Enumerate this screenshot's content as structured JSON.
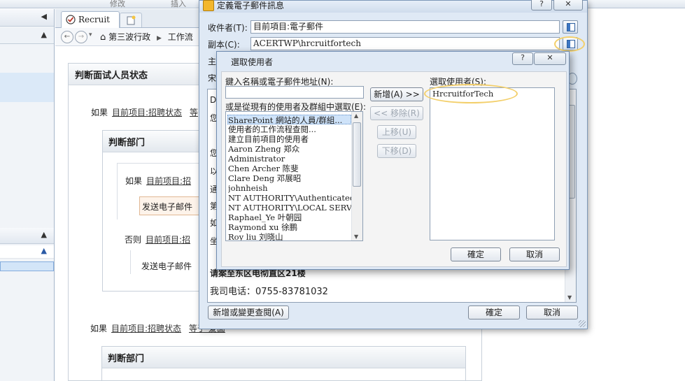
{
  "background": {
    "ribbon_labels": [
      "修改",
      "插入"
    ],
    "tab_label": "Recruit",
    "breadcrumb": [
      "第三波行政",
      "工作流"
    ],
    "main_box_title": "判断面试人员状态",
    "if_label": "如果",
    "field_ref": "目前项目:招聘状态",
    "eq_fragment": "等",
    "sub_box_title": "判断部门",
    "nested_field_ref": "目前项目:招",
    "send_email_label": "发送电子邮件",
    "else_label": "否则",
    "if2_field": "目前项目:招聘状态",
    "if2_tail": "等于 爱面",
    "sub_box2_title": "判断部门"
  },
  "outer_dialog": {
    "title": "定義電子郵件訊息",
    "help_btn": "?",
    "close_btn": "✕",
    "to_label": "收件者(T):",
    "to_value": "目前項目:電子郵件",
    "cc_label": "副本(C):",
    "cc_value": "ACERTWP\\hrcruitfortech",
    "subject_label": "主",
    "subject_value_fragment": "宋",
    "body_fragments": [
      "D",
      "您",
      "您",
      "以",
      "通",
      "第",
      "如",
      "坐"
    ],
    "body_address": "请案至东区电彻直区21楼",
    "body_phone": "我司电话：0755-83781032",
    "add_lookup_btn": "新增或變更查閱(A)",
    "ok_btn": "確定",
    "cancel_btn": "取消"
  },
  "inner_dialog": {
    "title": "選取使用者",
    "help_btn": "?",
    "close_btn": "✕",
    "name_label": "鍵入名稱或電子郵件地址(N):",
    "name_value": "",
    "choose_label": "或是從現有的使用者及群組中選取(E):",
    "existing_items": [
      "SharePoint 網站的人員/群組...",
      "使用者的工作流程查閱...",
      "建立目前項目的使用者",
      "Aaron Zheng 郑众",
      "Administrator",
      "Chen Archer 陈斐",
      "Clare Deng 邓展昭",
      "johnheish",
      "NT AUTHORITY\\Authenticated Users",
      "NT AUTHORITY\\LOCAL SERVICE",
      "Raphael_Ye 叶朝园",
      "Raymond xu 徐鹏",
      "Roy liu 刘晓山"
    ],
    "selected_existing_index": 0,
    "add_btn": "新增(A) >>",
    "remove_btn": "<< 移除(R)",
    "up_btn": "上移(U)",
    "down_btn": "下移(D)",
    "selected_label": "選取使用者(S):",
    "selected_items": [
      "HrcruitforTech"
    ],
    "ok_btn": "確定",
    "cancel_btn": "取消"
  },
  "colors": {
    "highlight_ellipse": "#f3cf6a",
    "dialog_frame": "#dfe9f5",
    "selection_blue": "#cfe3f9"
  }
}
